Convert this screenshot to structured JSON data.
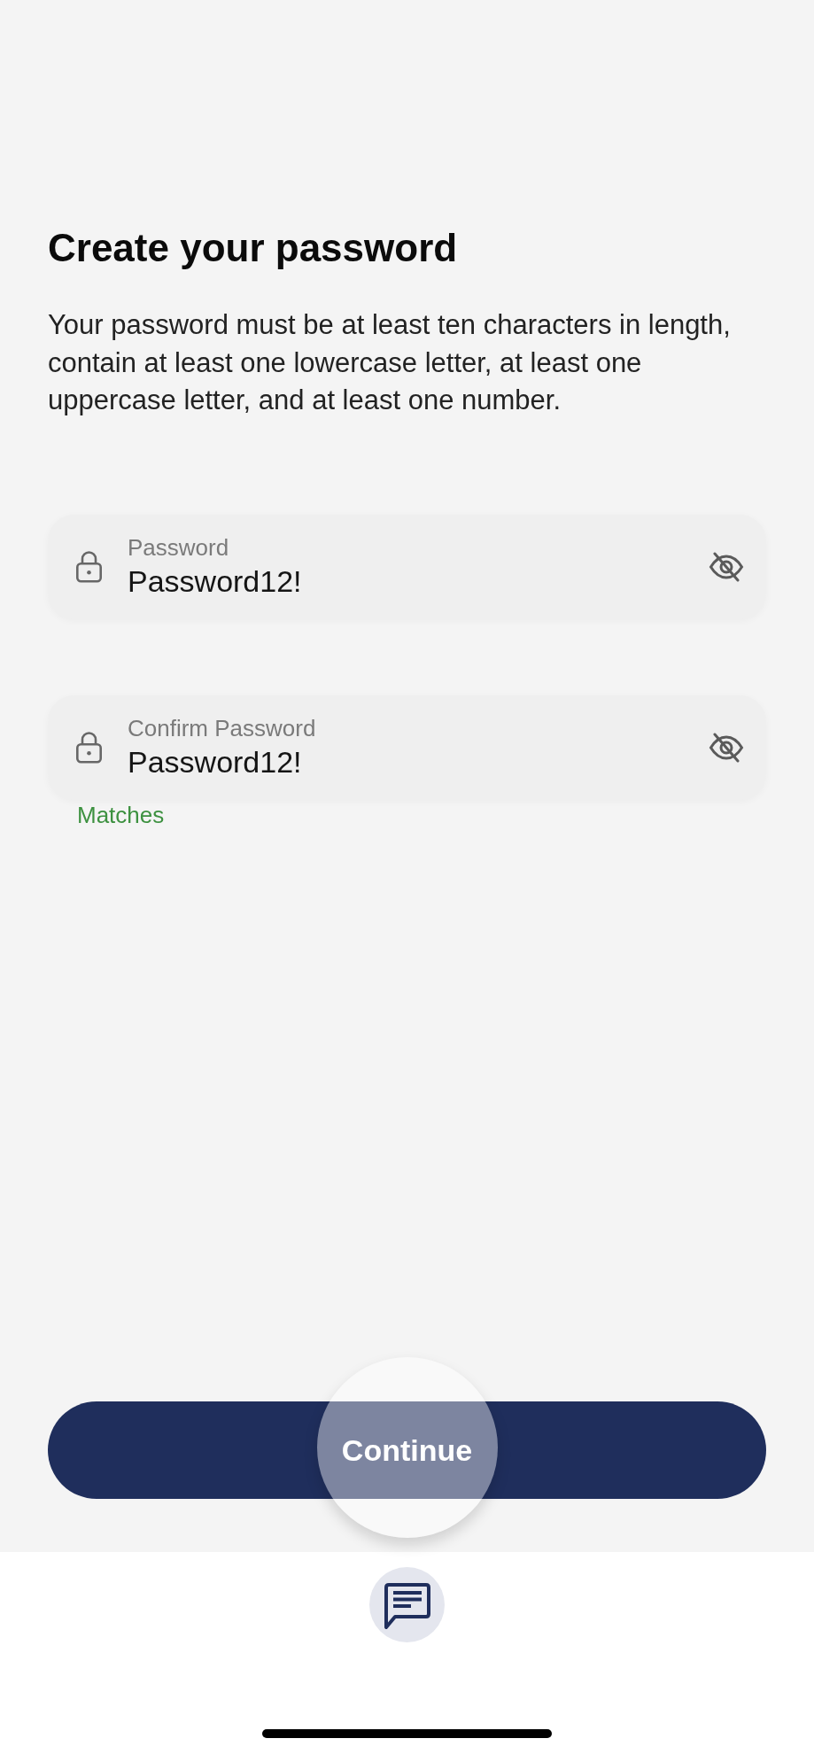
{
  "heading": "Create your password",
  "description": "Your password must be at least ten characters in length, contain at least one lowercase letter, at least one uppercase letter, and at least one number.",
  "fields": [
    {
      "label": "Password",
      "value": "Password12!",
      "revealed": true
    },
    {
      "label": "Confirm Password",
      "value": "Password12!",
      "revealed": true
    }
  ],
  "match_hint": "Matches",
  "continue_button": {
    "label": "Continue"
  }
}
